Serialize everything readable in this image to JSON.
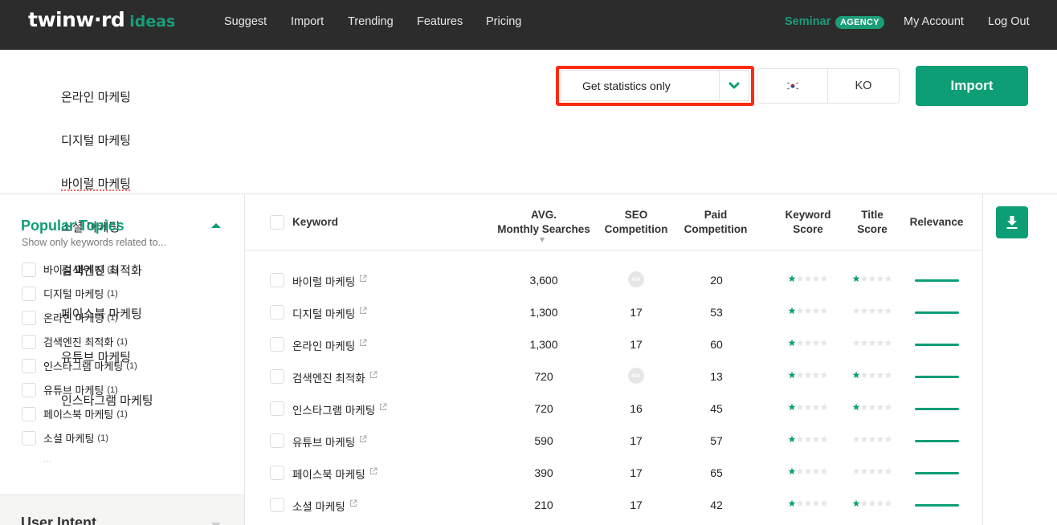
{
  "nav": {
    "logo_main": "twinw·rd",
    "logo_sub": "ideas",
    "links": [
      "Suggest",
      "Import",
      "Trending",
      "Features",
      "Pricing"
    ],
    "seminar": "Seminar",
    "agency_badge": "AGENCY",
    "my_account": "My Account",
    "log_out": "Log Out"
  },
  "keywords_input": {
    "lines": [
      "온라인 마케팅",
      "디지털 마케팅",
      "바이럴 마케팅",
      "소셜 마케팅",
      "검색엔진 최적화",
      "페이스북 마케팅",
      "유튜브 마케팅",
      "인스타그램 마케팅"
    ]
  },
  "controls": {
    "mode_select": "Get statistics only",
    "country_flag": "south-korea-flag",
    "language": "KO",
    "import_button": "Import"
  },
  "sidebar": {
    "popular_topics": {
      "title": "Popular Topics",
      "subtitle": "Show only keywords related to...",
      "items": [
        {
          "label": "바이럴 마케팅",
          "count": "(1)"
        },
        {
          "label": "디지털 마케팅",
          "count": "(1)"
        },
        {
          "label": "온라인 마케팅",
          "count": "(1)"
        },
        {
          "label": "검색엔진 최적화",
          "count": "(1)"
        },
        {
          "label": "인스타그램 마케팅",
          "count": "(1)"
        },
        {
          "label": "유튜브 마케팅",
          "count": "(1)"
        },
        {
          "label": "페이스북 마케팅",
          "count": "(1)"
        },
        {
          "label": "소셜 마케팅",
          "count": "(1)"
        }
      ],
      "more": "..."
    },
    "user_intent": {
      "title": "User Intent"
    }
  },
  "table": {
    "headers": {
      "keyword": "Keyword",
      "avg_line1": "AVG.",
      "avg_line2": "Monthly Searches",
      "seo_line1": "SEO",
      "seo_line2": "Competition",
      "paid_line1": "Paid",
      "paid_line2": "Competition",
      "kscore_line1": "Keyword",
      "kscore_line2": "Score",
      "tscore_line1": "Title",
      "tscore_line2": "Score",
      "relevance": "Relevance"
    },
    "na_label": "N/A",
    "rows": [
      {
        "keyword": "바이럴 마케팅",
        "avg": "3,600",
        "seo": "N/A",
        "paid": "20",
        "keyword_score": 1,
        "title_score": 1,
        "relevance": 1.0
      },
      {
        "keyword": "디지털 마케팅",
        "avg": "1,300",
        "seo": "17",
        "paid": "53",
        "keyword_score": 1,
        "title_score": 0,
        "relevance": 1.0
      },
      {
        "keyword": "온라인 마케팅",
        "avg": "1,300",
        "seo": "17",
        "paid": "60",
        "keyword_score": 1,
        "title_score": 0,
        "relevance": 1.0
      },
      {
        "keyword": "검색엔진 최적화",
        "avg": "720",
        "seo": "N/A",
        "paid": "13",
        "keyword_score": 1,
        "title_score": 1,
        "relevance": 1.0
      },
      {
        "keyword": "인스타그램 마케팅",
        "avg": "720",
        "seo": "16",
        "paid": "45",
        "keyword_score": 1,
        "title_score": 1,
        "relevance": 1.0
      },
      {
        "keyword": "유튜브 마케팅",
        "avg": "590",
        "seo": "17",
        "paid": "57",
        "keyword_score": 1,
        "title_score": 0,
        "relevance": 1.0
      },
      {
        "keyword": "페이스북 마케팅",
        "avg": "390",
        "seo": "17",
        "paid": "65",
        "keyword_score": 1,
        "title_score": 0,
        "relevance": 1.0
      },
      {
        "keyword": "소셜 마케팅",
        "avg": "210",
        "seo": "17",
        "paid": "42",
        "keyword_score": 1,
        "title_score": 1,
        "relevance": 1.0
      }
    ],
    "max_stars": 5
  },
  "colors": {
    "brand_green": "#0d9e76",
    "nav_bg": "#2c2c2c",
    "highlight_red": "#ff2a12",
    "star_empty": "#e6e6e6"
  }
}
